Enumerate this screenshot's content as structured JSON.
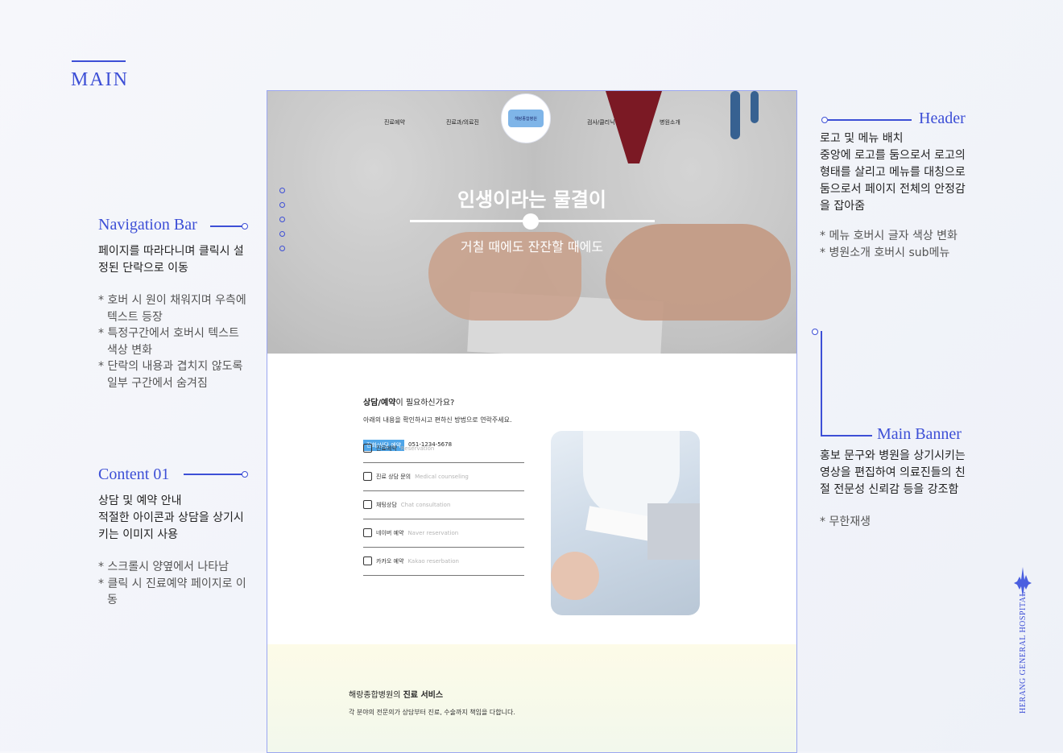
{
  "section": {
    "title": "MAIN"
  },
  "annotations": {
    "navigation": {
      "title": "Navigation Bar",
      "desc": [
        "페이지를 따라다니며 클릭시 설",
        "정된 단락으로 이동"
      ],
      "notes": [
        "* 호버 시 원이 채워지며 우측에 텍스트 등장",
        "* 특정구간에서 호버시 텍스트 색상 변화",
        "* 단락의 내용과 겹치지 않도록 일부 구간에서 숨겨짐"
      ]
    },
    "content": {
      "title": "Content 01",
      "desc": [
        "상담 및 예약 안내",
        "적절한 아이콘과 상담을 상기시",
        "키는 이미지 사용"
      ],
      "notes": [
        "* 스크롤시 양옆에서 나타남",
        "* 클릭 시 진료예약 페이지로 이동"
      ]
    },
    "header": {
      "title": "Header",
      "desc": [
        "로고 및 메뉴 배치",
        "중앙에 로고를 둠으로서 로고의",
        "형태를 살리고 메뉴를 대칭으로",
        "둠으로서 페이지 전체의 안정감",
        "을 잡아줌"
      ],
      "notes": [
        "* 메뉴 호버시 글자 색상 변화",
        "* 병원소개 호버시 sub메뉴"
      ]
    },
    "banner": {
      "title": "Main Banner",
      "desc": [
        "홍보 문구와 병원을 상기시키는",
        "영상을 편집하여 의료진들의 친",
        "절 전문성 신뢰감 등을 강조함"
      ],
      "notes": [
        "* 무한재생"
      ]
    }
  },
  "mockup": {
    "nav": [
      "진료예약",
      "진료과/의료진",
      "검사/클리닉",
      "병원소개"
    ],
    "logo_text": "해랑종합병원",
    "logo_ring": "Herang general hospital",
    "hero": {
      "title": "인생이라는 물결이",
      "subtitle": "거칠 때에도 잔잔할 때에도"
    },
    "consult": {
      "title_bold": "상담/예약",
      "title_rest": "이 필요하신가요?",
      "desc": "아래의 내용을 확인하시고 편하신 방법으로 연락주세요.",
      "badge": "전화/상담 예약",
      "phone": "051-1234-5678",
      "items": [
        {
          "ko": "진료예약",
          "en": "Reservation"
        },
        {
          "ko": "진료 상담 문의",
          "en": "Medical counseling"
        },
        {
          "ko": "채팅상담",
          "en": "Chat consultation"
        },
        {
          "ko": "네이버 예약",
          "en": "Naver reservation"
        },
        {
          "ko": "카카오 예약",
          "en": "Kakao reserbation"
        }
      ]
    },
    "service": {
      "title_prefix": "해랑종합병원의 ",
      "title_bold": "진료 서비스",
      "desc": "각 분야의 전문의가 상담부터 진료, 수술까지 책임을 다합니다."
    }
  },
  "brand": {
    "vertical_text": "HERANG GENERAL HOSPITAL",
    "accent": "#3d4fd6"
  }
}
